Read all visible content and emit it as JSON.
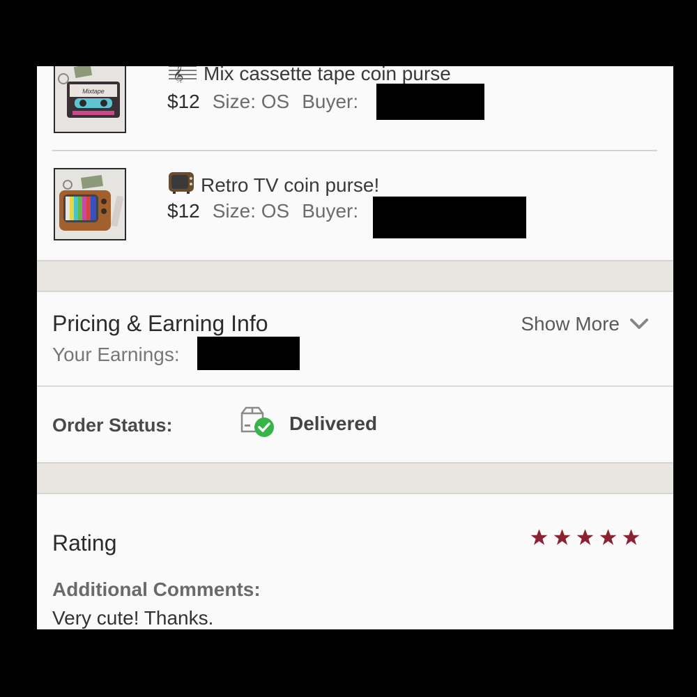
{
  "items": [
    {
      "emoji_icon": "music-staff-icon",
      "title": "Mix cassette tape coin purse",
      "price": "$12",
      "size": "Size: OS",
      "buyer_label": "Buyer:"
    },
    {
      "emoji_icon": "television-icon",
      "title": "Retro TV coin purse!",
      "price": "$12",
      "size": "Size: OS",
      "buyer_label": "Buyer:"
    }
  ],
  "pricing": {
    "title": "Pricing & Earning Info",
    "earnings_label": "Your Earnings:",
    "show_more": "Show More"
  },
  "order_status": {
    "label": "Order Status:",
    "value": "Delivered",
    "icon": "delivered-box-icon"
  },
  "rating": {
    "title": "Rating",
    "stars": 5,
    "star_color": "#8b2232",
    "comments_label": "Additional Comments:",
    "comments": "Very cute! Thanks."
  },
  "thumb_text": {
    "cassette_label": "Mixtape"
  }
}
